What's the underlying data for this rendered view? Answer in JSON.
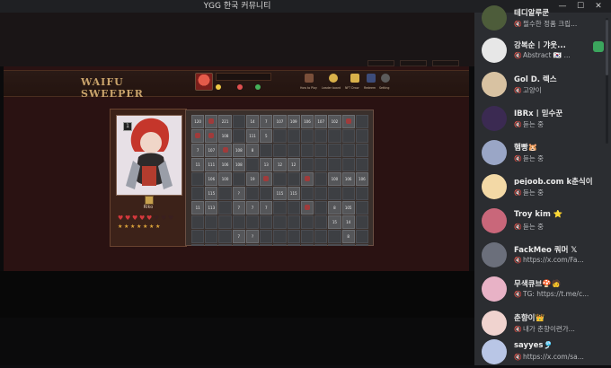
{
  "window": {
    "title": "YGG 한국 커뮤니티"
  },
  "game": {
    "logo": "WAIFU SWEEPER",
    "toolbar": [
      {
        "label": "How to Play",
        "icon": "book-icon"
      },
      {
        "label": "Leader board",
        "icon": "trophy-icon"
      },
      {
        "label": "NFT Draw",
        "icon": "draw-icon"
      },
      {
        "label": "Redeem",
        "icon": "redeem-icon"
      },
      {
        "label": "Setting",
        "icon": "gear-icon"
      }
    ],
    "character_name": "Riko",
    "board": [
      [
        "120",
        "mine",
        "221",
        "",
        "14",
        "7",
        "107",
        "109",
        "106",
        "107",
        "102",
        "mine",
        ""
      ],
      [
        "mine",
        "mine",
        "108",
        "",
        "111",
        "5",
        "",
        "",
        "",
        "",
        "",
        "",
        ""
      ],
      [
        "7",
        "107",
        "mine",
        "108",
        "8",
        "",
        "",
        "",
        "",
        "",
        "",
        "",
        ""
      ],
      [
        "11",
        "111",
        "106",
        "108",
        "",
        "13",
        "12",
        "12",
        "",
        "",
        "",
        "",
        ""
      ],
      [
        "",
        "106",
        "100",
        "",
        "19",
        "mine",
        "",
        "",
        "mine",
        "",
        "100",
        "106",
        "106"
      ],
      [
        "",
        "115",
        "",
        "?",
        "",
        "",
        "115",
        "115",
        "",
        "",
        "",
        "",
        ""
      ],
      [
        "11",
        "113",
        "",
        "7",
        "7",
        "7",
        "",
        "",
        "mine",
        "",
        "8",
        "105",
        ""
      ],
      [
        "",
        "",
        "",
        "",
        "",
        "",
        "",
        "",
        "",
        "",
        "15",
        "14",
        ""
      ],
      [
        "",
        "",
        "",
        "7",
        "?",
        "",
        "",
        "",
        "",
        "",
        "",
        "8",
        ""
      ],
      [
        "",
        "",
        "",
        "",
        "",
        "",
        "",
        "",
        "",
        "",
        "",
        "",
        ""
      ]
    ]
  },
  "sidebar": {
    "items": [
      {
        "name": "테디알루쿤",
        "status": "필수한 정품 크립..."
      },
      {
        "name": "강복순 | 갸웃...",
        "status": "Abstract 🇰🇷 ..."
      },
      {
        "name": "Gol D. 렉스",
        "status": "고양이"
      },
      {
        "name": "IBRx | 믿수꾼",
        "status": "듣는 중"
      },
      {
        "name": "햄빵🐹",
        "status": "듣는 중"
      },
      {
        "name": "pejoob.com k춘식이",
        "status": "듣는 중"
      },
      {
        "name": "Troy kim ⭐",
        "status": "듣는 중"
      },
      {
        "name": "FackMeo 쿼머 𝕏",
        "status": "https://x.com/Fa..."
      },
      {
        "name": "무색큐브🍄🧑",
        "status": "TG: https://t.me/c..."
      },
      {
        "name": "춘향이👑",
        "status": "내가 춘향이련가..."
      },
      {
        "name": "sayyes🎐",
        "status": "https://x.com/sa..."
      }
    ]
  },
  "colors": {
    "sidebar_bg": "#2b2d31",
    "board_bg": "#3a302c",
    "cell": "#555659"
  }
}
